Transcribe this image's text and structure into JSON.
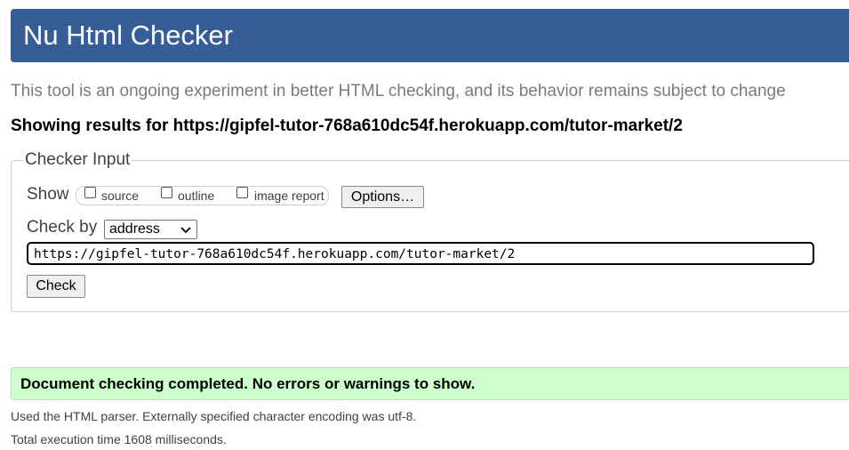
{
  "header": {
    "title": "Nu Html Checker"
  },
  "intro": "This tool is an ongoing experiment in better HTML checking, and its behavior remains subject to change",
  "results": {
    "heading": "Showing results for https://gipfel-tutor-768a610dc54f.herokuapp.com/tutor-market/2"
  },
  "checker_input": {
    "legend": "Checker Input",
    "show_label": "Show",
    "options": [
      {
        "label": "source",
        "checked": false
      },
      {
        "label": "outline",
        "checked": false
      },
      {
        "label": "image report",
        "checked": false
      }
    ],
    "options_button": "Options…",
    "check_by_label": "Check by",
    "check_by_selected": "address",
    "url_value": "https://gipfel-tutor-768a610dc54f.herokuapp.com/tutor-market/2",
    "check_button": "Check"
  },
  "status": {
    "message": "Document checking completed. No errors or warnings to show.",
    "color": "#ccffcc"
  },
  "notes": {
    "parser": "Used the HTML parser. Externally specified character encoding was utf-8.",
    "time": "Total execution time 1608 milliseconds."
  },
  "colors": {
    "header_bg": "#365d95",
    "header_text": "#ffffff"
  }
}
